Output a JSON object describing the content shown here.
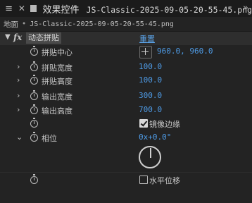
{
  "panel": {
    "tab_title": "效果控件",
    "file_name": "JS-Classic-2025-09-05-20-55-45.png"
  },
  "breadcrumb": {
    "comp": "地面",
    "separator": "•",
    "layer": "JS-Classic-2025-09-05-20-55-45.png"
  },
  "effect": {
    "fx_label": "fx",
    "name": "动态拼贴",
    "reset_label": "重置"
  },
  "properties": [
    {
      "label": "拼贴中心",
      "value": "960.0, 960.0"
    },
    {
      "label": "拼贴宽度",
      "value": "100.0"
    },
    {
      "label": "拼贴高度",
      "value": "100.0"
    },
    {
      "label": "输出宽度",
      "value": "300.0"
    },
    {
      "label": "输出高度",
      "value": "700.0"
    },
    {
      "label": "",
      "checkbox_label": "镜像边缘",
      "checked": true
    },
    {
      "label": "相位",
      "value": "0x+0.0°"
    },
    {
      "label": "",
      "checkbox_label": "水平位移",
      "checked": false
    }
  ],
  "colors": {
    "accent": "#4e9be6",
    "background": "#232323"
  }
}
